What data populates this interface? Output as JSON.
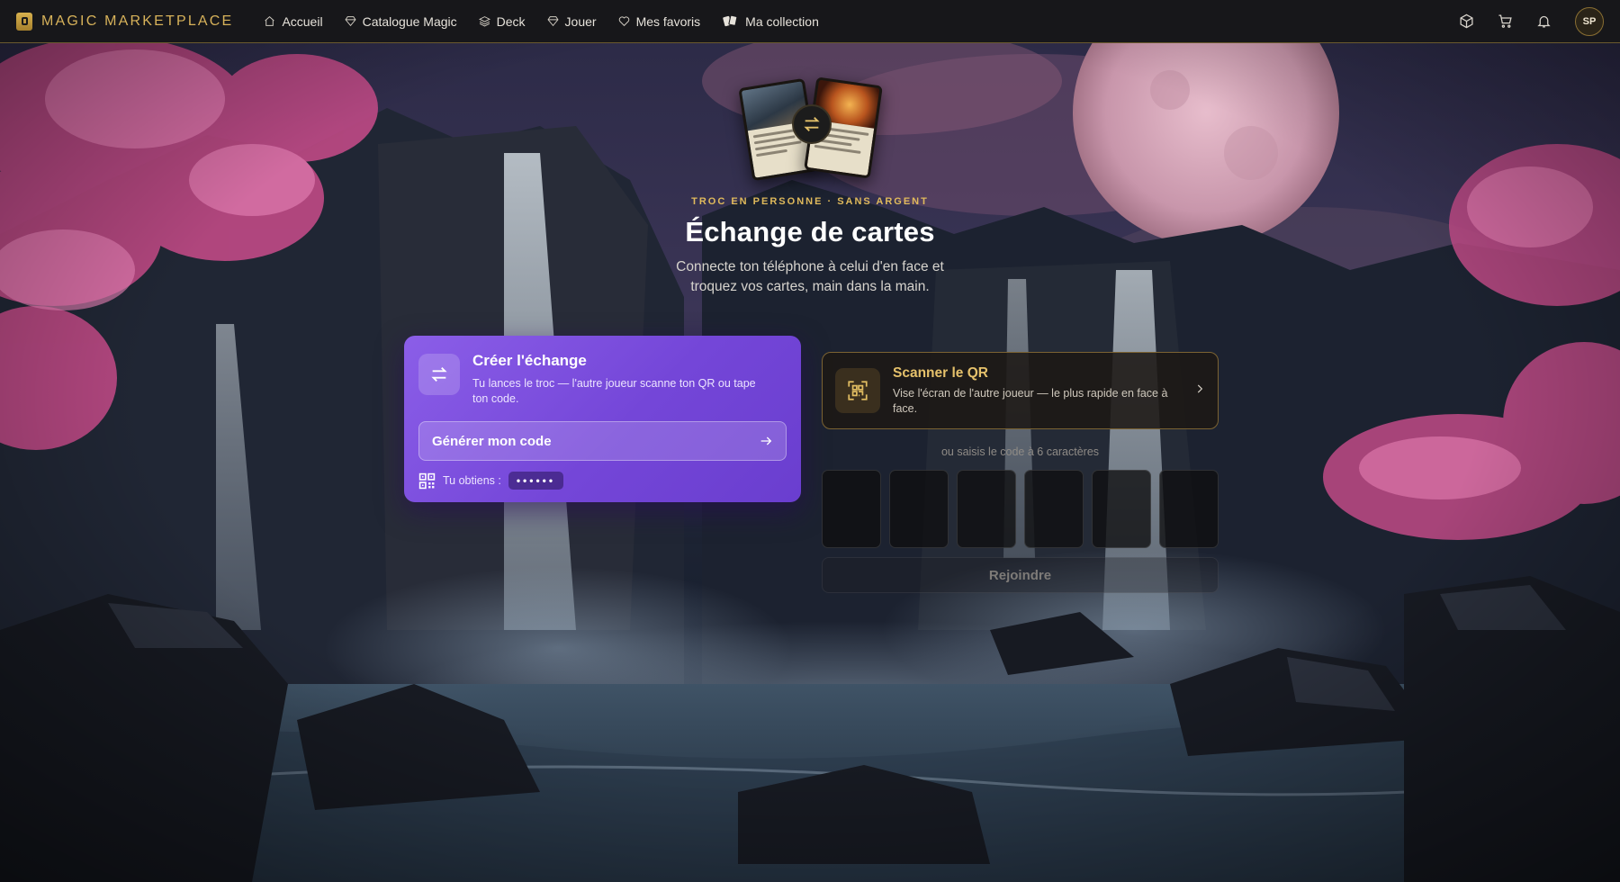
{
  "brand": {
    "name": "MAGIC MARKETPLACE"
  },
  "nav": {
    "items": [
      {
        "label": "Accueil",
        "icon": "home-icon"
      },
      {
        "label": "Catalogue Magic",
        "icon": "gem-icon"
      },
      {
        "label": "Deck",
        "icon": "layers-icon"
      },
      {
        "label": "Jouer",
        "icon": "gem-icon"
      },
      {
        "label": "Mes favoris",
        "icon": "heart-icon"
      },
      {
        "label": "Ma collection",
        "icon": "cards-icon"
      }
    ],
    "right_icons": [
      "cube-icon",
      "cart-icon",
      "bell-icon"
    ],
    "avatar_initials": "SP"
  },
  "hero": {
    "eyebrow": "TROC EN PERSONNE · SANS ARGENT",
    "title": "Échange de cartes",
    "subtitle": "Connecte ton téléphone à celui d'en face et troquez vos cartes, main dans la main."
  },
  "create": {
    "title": "Créer l'échange",
    "description": "Tu lances le troc — l'autre joueur scanne ton QR ou tape ton code.",
    "button_label": "Générer mon code",
    "obtain_label": "Tu obtiens :",
    "code_mask": "••••••"
  },
  "join": {
    "scan_title": "Scanner le QR",
    "scan_description": "Vise l'écran de l'autre joueur — le plus rapide en face à face.",
    "code_hint": "ou saisis le code à 6 caractères",
    "code_slots": [
      "",
      "",
      "",
      "",
      "",
      ""
    ],
    "join_button_label": "Rejoindre"
  },
  "colors": {
    "accent_gold": "#e0ba5c",
    "create_purple": "#7a4be0",
    "nav_bg": "#17171a"
  }
}
